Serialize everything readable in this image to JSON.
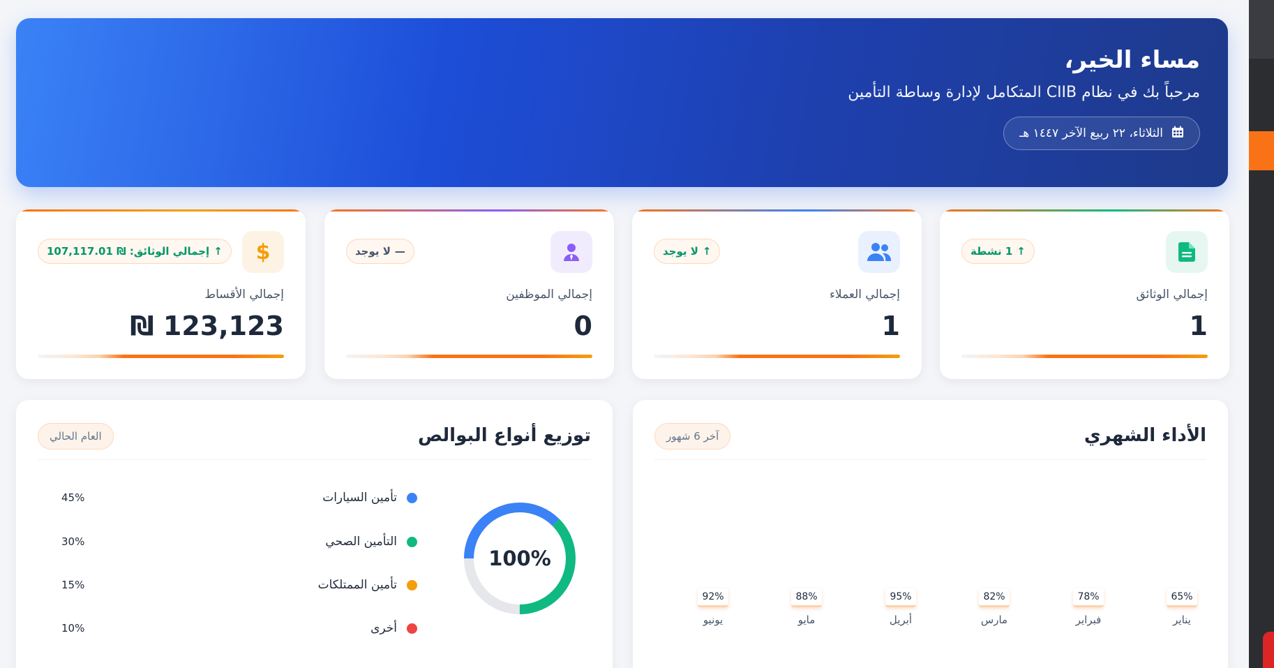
{
  "hero": {
    "title": "مساء الخير،",
    "subtitle": "مرحباً بك في نظام CIIB المتكامل لإدارة وساطة التأمين",
    "date": "الثلاثاء، ٢٢ ربيع الآخر ١٤٤٧ هـ",
    "date_icon": "calendar-icon"
  },
  "stats": [
    {
      "label": "إجمالي الوثائق",
      "value": "1",
      "badge": "1 نشطة",
      "badge_trend": "up",
      "icon": "document-icon",
      "icon_color": "#10b981",
      "icon_bg": "#e6f7f1"
    },
    {
      "label": "إجمالي العملاء",
      "value": "1",
      "badge": "لا يوجد",
      "badge_trend": "up",
      "icon": "users-icon",
      "icon_color": "#3b82f6",
      "icon_bg": "#eaf1fe"
    },
    {
      "label": "إجمالي الموظفين",
      "value": "0",
      "badge": "لا يوجد",
      "badge_trend": "neutral",
      "icon": "employee-icon",
      "icon_color": "#8b5cf6",
      "icon_bg": "#f1ecfd"
    },
    {
      "label": "إجمالي الأقساط",
      "value": "123,123 ₪",
      "badge": "إجمالي الوثائق: ₪ 107,117.01",
      "badge_trend": "up",
      "icon": "dollar-icon",
      "icon_color": "#f59e0b",
      "icon_bg": "#fdf3e4"
    }
  ],
  "distribution": {
    "title": "توزيع أنواع البوالص",
    "chip": "العام الحالي",
    "center_label": "100%",
    "items": [
      {
        "name": "تأمين السيارات",
        "pct": "45%",
        "color": "#3b82f6"
      },
      {
        "name": "التأمين الصحي",
        "pct": "30%",
        "color": "#10b981"
      },
      {
        "name": "تأمين الممتلكات",
        "pct": "15%",
        "color": "#f59e0b"
      },
      {
        "name": "أخرى",
        "pct": "10%",
        "color": "#ef4444"
      }
    ]
  },
  "monthly": {
    "title": "الأداء الشهري",
    "chip": "آخر 6 شهور",
    "months": [
      {
        "name": "يناير",
        "pct": "65%"
      },
      {
        "name": "فبراير",
        "pct": "78%"
      },
      {
        "name": "مارس",
        "pct": "82%"
      },
      {
        "name": "أبريل",
        "pct": "95%"
      },
      {
        "name": "مايو",
        "pct": "88%"
      },
      {
        "name": "يونيو",
        "pct": "92%"
      }
    ]
  },
  "colors": {
    "accent": "#f97316",
    "primary": "#1d4ed8"
  }
}
